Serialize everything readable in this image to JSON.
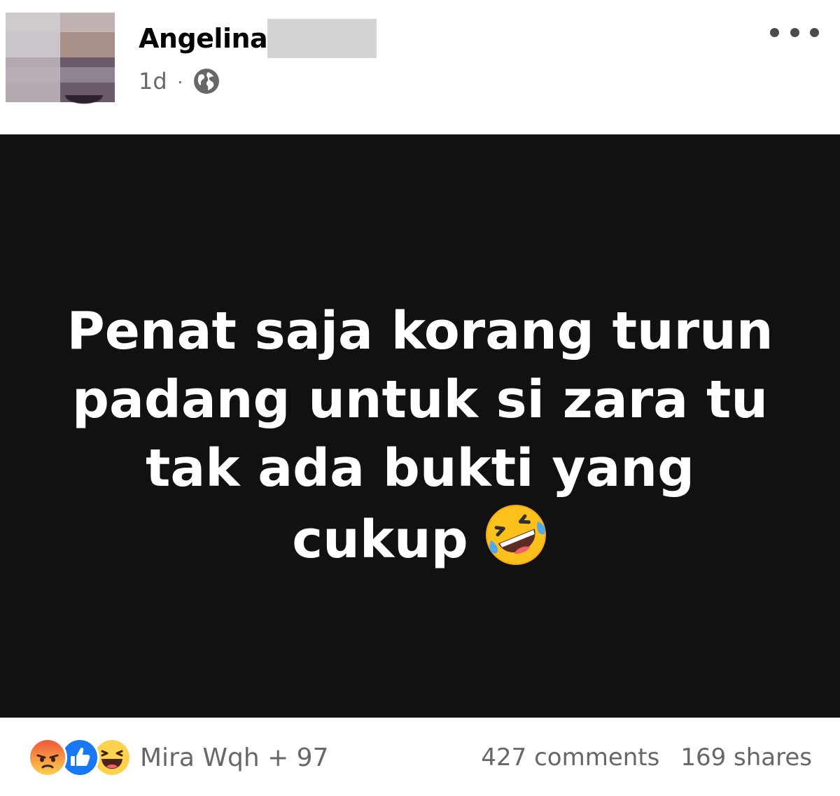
{
  "post": {
    "author_name": "Angelina",
    "timestamp": "1d",
    "separator": "·",
    "privacy_icon": "globe-icon",
    "more_icon": "more-options-icon",
    "text_lines": [
      "Penat saja korang turun",
      "padang untuk si zara tu",
      "tak ada bukti yang",
      "cukup"
    ],
    "emoji": "rolling-on-floor-laughing-emoji"
  },
  "footer": {
    "reactions": [
      "angry-reaction-icon",
      "like-reaction-icon",
      "haha-reaction-icon"
    ],
    "reactors_text": "Mira Wqh + 97",
    "comments_text": "427 comments",
    "shares_text": "169 shares"
  },
  "colors": {
    "image_background": "#111111",
    "secondary_text": "#65676b",
    "like_blue": "#1877f2",
    "angry_orange": "#f0583a",
    "haha_yellow": "#fcd14d"
  }
}
